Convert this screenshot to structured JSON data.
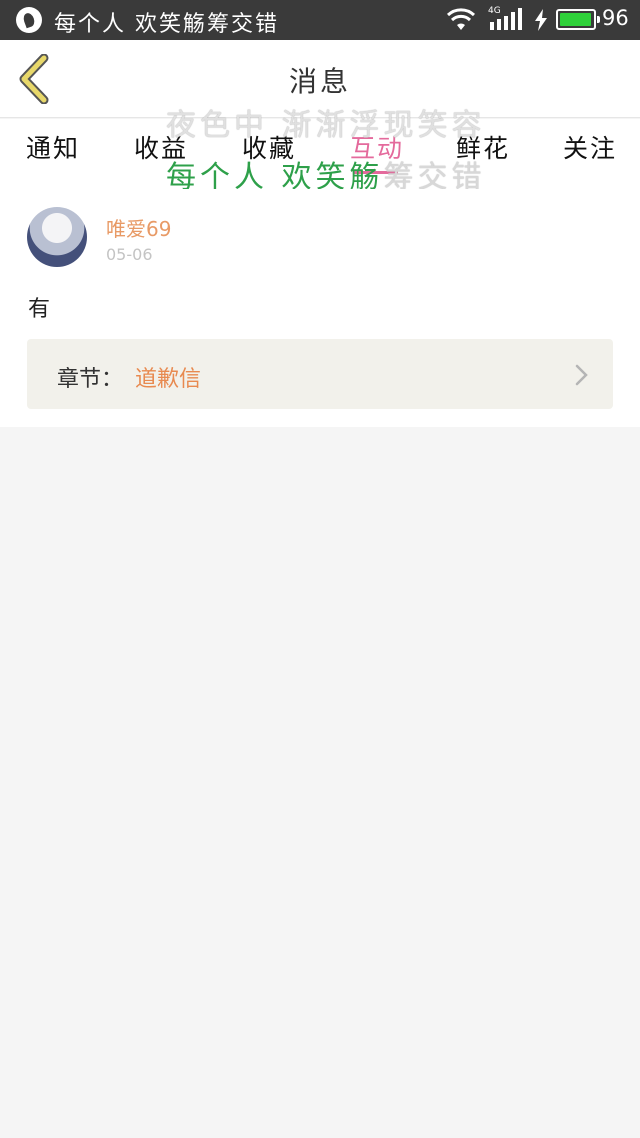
{
  "status_bar": {
    "title": "每个人 欢笑觞筹交错",
    "network": "4G",
    "battery_level": "96",
    "battery_percent": 96,
    "icons": [
      "app-icon",
      "wifi-icon",
      "signal-icon",
      "charging-icon",
      "battery-icon"
    ],
    "battery_color": "#2fd13a"
  },
  "header": {
    "title": "消息",
    "back_icon": "chevron-left-icon"
  },
  "overlay": {
    "line1": "夜色中 渐渐浮现笑容",
    "line2_a": "每个人 欢笑觞",
    "line2_b": "筹交错"
  },
  "tabs": [
    {
      "label": "通知"
    },
    {
      "label": "收益"
    },
    {
      "label": "收藏"
    },
    {
      "label": "互动"
    },
    {
      "label": "鲜花"
    },
    {
      "label": "关注"
    }
  ],
  "active_tab": "互动",
  "message": {
    "username": "唯爱69",
    "date": "05-06",
    "content": "有",
    "chapter_label": "章节：",
    "chapter_name": "道歉信",
    "arrow_icon": "chevron-right-icon"
  },
  "colors": {
    "accent_pink": "#e46a9c",
    "username_orange": "#e89a66",
    "chapter_orange": "#e88a50",
    "back_yellow": "#e8d86a",
    "overlay_green": "#2ea04a"
  }
}
